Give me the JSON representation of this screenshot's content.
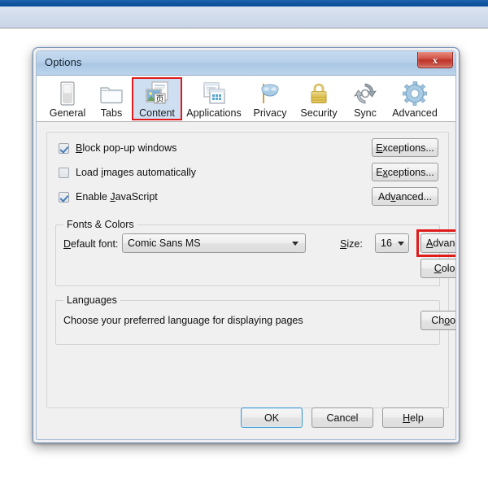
{
  "window": {
    "title": "Options",
    "close_label": "x",
    "close_icon": "close-icon"
  },
  "tabs": [
    {
      "label": "General",
      "icon": "window-pane-icon",
      "selected": false
    },
    {
      "label": "Tabs",
      "icon": "folder-tab-icon",
      "selected": false
    },
    {
      "label": "Content",
      "icon": "web-page-icon",
      "selected": true
    },
    {
      "label": "Applications",
      "icon": "app-windows-icon",
      "selected": false
    },
    {
      "label": "Privacy",
      "icon": "mask-icon",
      "selected": false
    },
    {
      "label": "Security",
      "icon": "padlock-icon",
      "selected": false
    },
    {
      "label": "Sync",
      "icon": "sync-arrows-icon",
      "selected": false
    },
    {
      "label": "Advanced",
      "icon": "gear-icon",
      "selected": false
    }
  ],
  "content": {
    "checkboxes": [
      {
        "label_pre": "B",
        "label_accel": "",
        "label": "Block pop-up windows",
        "accel_char": "B",
        "checked": true,
        "button": "Exceptions...",
        "button_accel": "E"
      },
      {
        "label": "Load images automatically",
        "accel_char": "i",
        "checked": false,
        "button": "Exceptions...",
        "button_accel": "x"
      },
      {
        "label": "Enable JavaScript",
        "accel_char": "J",
        "checked": true,
        "button": "Advanced...",
        "button_accel": "v"
      }
    ],
    "fonts_group": {
      "title": "Fonts & Colors",
      "default_font_label": "Default font:",
      "default_font_accel": "D",
      "default_font_value": "Comic Sans MS",
      "size_label": "Size:",
      "size_accel": "S",
      "size_value": "16",
      "advanced_button": "Advanced...",
      "advanced_accel": "A",
      "colors_button": "Colors...",
      "colors_accel": "C",
      "highlighted": "advanced-button"
    },
    "languages_group": {
      "title": "Languages",
      "description": "Choose your preferred language for displaying pages",
      "choose_button": "Choose...",
      "choose_accel": "o"
    }
  },
  "footer": {
    "ok": "OK",
    "cancel": "Cancel",
    "help": "Help",
    "help_accel": "H"
  },
  "colors": {
    "highlight_red": "#e01b1b",
    "selected_tab_bg": "#cfdff2",
    "dialog_bg": "#f0f0f0",
    "titlebar_blue": "#b6cfe9",
    "focus_blue": "#3c99d4",
    "check_blue": "#4a7ebb"
  }
}
